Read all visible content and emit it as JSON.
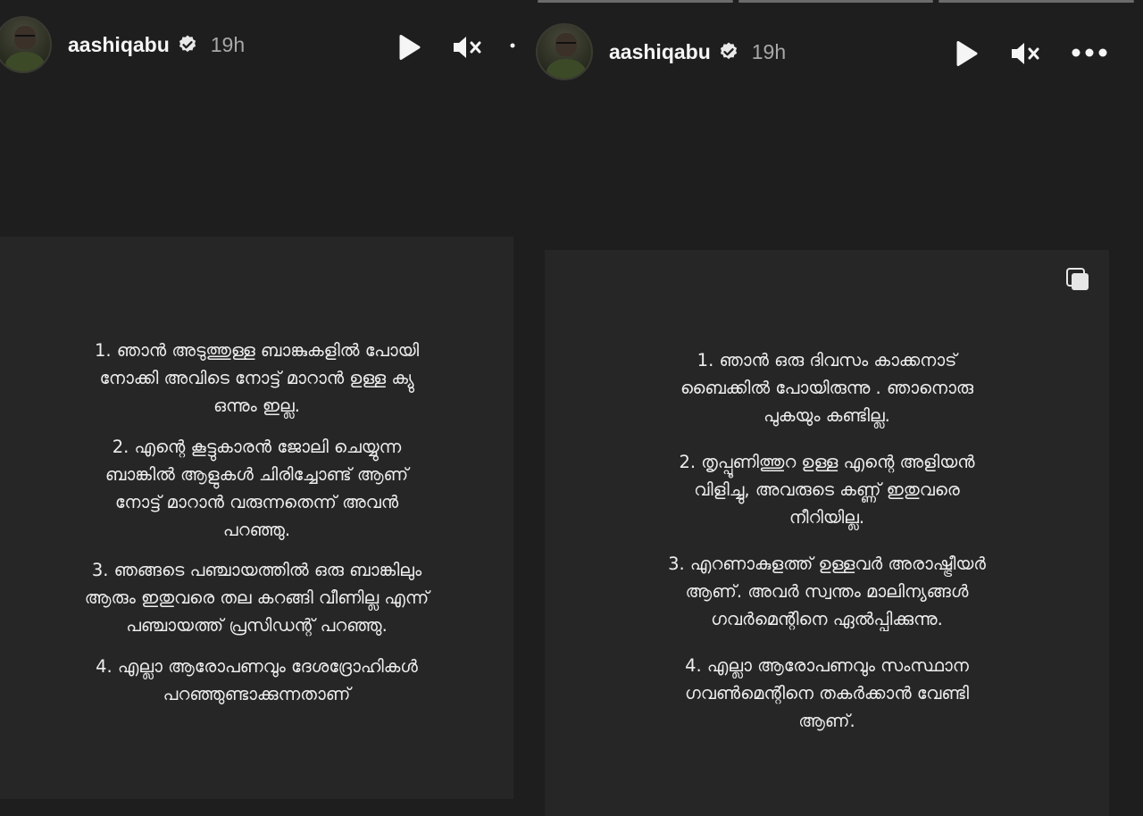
{
  "left_story": {
    "username": "aashiqabu",
    "time": "19h",
    "icons": {
      "play": "play-icon",
      "mute": "mute-icon",
      "verified": "verified-badge-icon"
    },
    "items": [
      "1. ഞാൻ അടുത്തുള്ള ബാങ്കുകളിൽ പോയി\nനോക്കി അവിടെ നോട്ട് മാറാൻ ഉള്ള ക്യു\nഒന്നും ഇല്ല.",
      "2. എന്റെ കൂട്ടുകാരൻ ജോലി ചെയ്യുന്ന\nബാങ്കിൽ ആളുകൾ ചിരിച്ചോണ്ട് ആണ്\nനോട്ട് മാറാൻ വരുന്നതെന്ന് അവൻ\nപറഞ്ഞു.",
      "3. ഞങ്ങടെ പഞ്ചായത്തിൽ ഒരു ബാങ്കിലും\nആരും ഇതുവരെ തല കറങ്ങി വീണില്ല എന്ന്\nപഞ്ചായത്ത് പ്രസിഡന്റ് പറഞ്ഞു.",
      "4. എല്ലാ ആരോപണവും ദേശദ്രോഹികൾ\nപറഞ്ഞുണ്ടാക്കുന്നതാണ്"
    ]
  },
  "right_story": {
    "username": "aashiqabu",
    "time": "19h",
    "icons": {
      "play": "play-icon",
      "mute": "mute-icon",
      "more": "more-options-icon",
      "verified": "verified-badge-icon",
      "copy": "multiple-posts-icon"
    },
    "items": [
      "1. ഞാൻ ഒരു ദിവസം കാക്കനാട്\nബൈക്കിൽ പോയിരുന്നു . ഞാനൊരു\nപുകയും കണ്ടില്ല.",
      "2. തൃപ്പൂണിത്തുറ ഉള്ള എന്റെ അളിയൻ\nവിളിച്ചു, അവരുടെ കണ്ണ് ഇതുവരെ\nനീറിയില്ല.",
      "3. എറണാകുളത്ത് ഉള്ളവർ അരാഷ്ട്രീയർ\nആണ്. അവർ സ്വന്തം മാലിന്യങ്ങൾ\nഗവർമെന്റിനെ ഏൽപ്പിക്കുന്നു.",
      "4. എല്ലാ ആരോപണവും സംസ്ഥാന\nഗവൺമെന്റിനെ തകർക്കാൻ വേണ്ടി\nആണ്."
    ]
  },
  "colors": {
    "background": "#1e1e1e",
    "card": "#262626",
    "text": "#ededed",
    "time": "#a8a8a8"
  }
}
